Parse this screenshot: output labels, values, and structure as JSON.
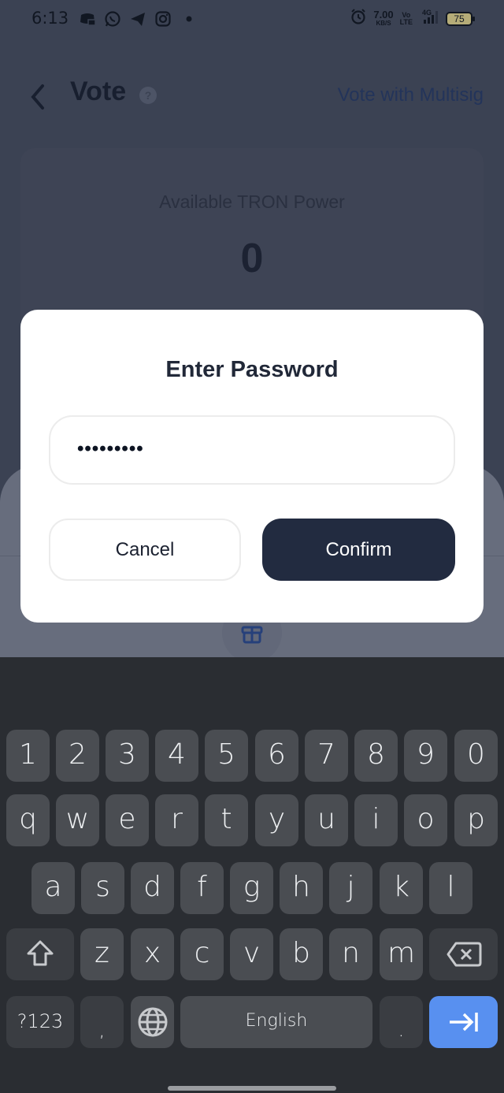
{
  "status_bar": {
    "time": "6:13",
    "notification_icons": [
      "discord-icon",
      "whatsapp-icon",
      "telegram-icon",
      "instagram-icon",
      "dot-icon"
    ],
    "alarm_icon": "alarm-icon",
    "net_speed": "7.00",
    "net_speed_unit": "KB/S",
    "volte_top": "Vo",
    "volte_bottom": "LTE",
    "network": "4G",
    "battery": "75"
  },
  "header": {
    "back_icon": "chevron-left-icon",
    "title": "Vote",
    "help_icon": "?",
    "multisig_link": "Vote with Multisig"
  },
  "power_card": {
    "label": "Available TRON Power",
    "value": "0"
  },
  "bottom_sheet": {
    "gift_icon": "gift-icon"
  },
  "dialog": {
    "title": "Enter Password",
    "password_value": "•••••••••",
    "cancel_label": "Cancel",
    "confirm_label": "Confirm"
  },
  "keyboard": {
    "row_numbers": [
      "1",
      "2",
      "3",
      "4",
      "5",
      "6",
      "7",
      "8",
      "9",
      "0"
    ],
    "row_top": [
      "q",
      "w",
      "e",
      "r",
      "t",
      "y",
      "u",
      "i",
      "o",
      "p"
    ],
    "row_middle": [
      "a",
      "s",
      "d",
      "f",
      "g",
      "h",
      "j",
      "k",
      "l"
    ],
    "row_bottom": [
      "z",
      "x",
      "c",
      "v",
      "b",
      "n",
      "m"
    ],
    "symbols_label": "?123",
    "comma": ",",
    "space_label": "English",
    "period": ".",
    "enter_color": "#5890f0"
  }
}
